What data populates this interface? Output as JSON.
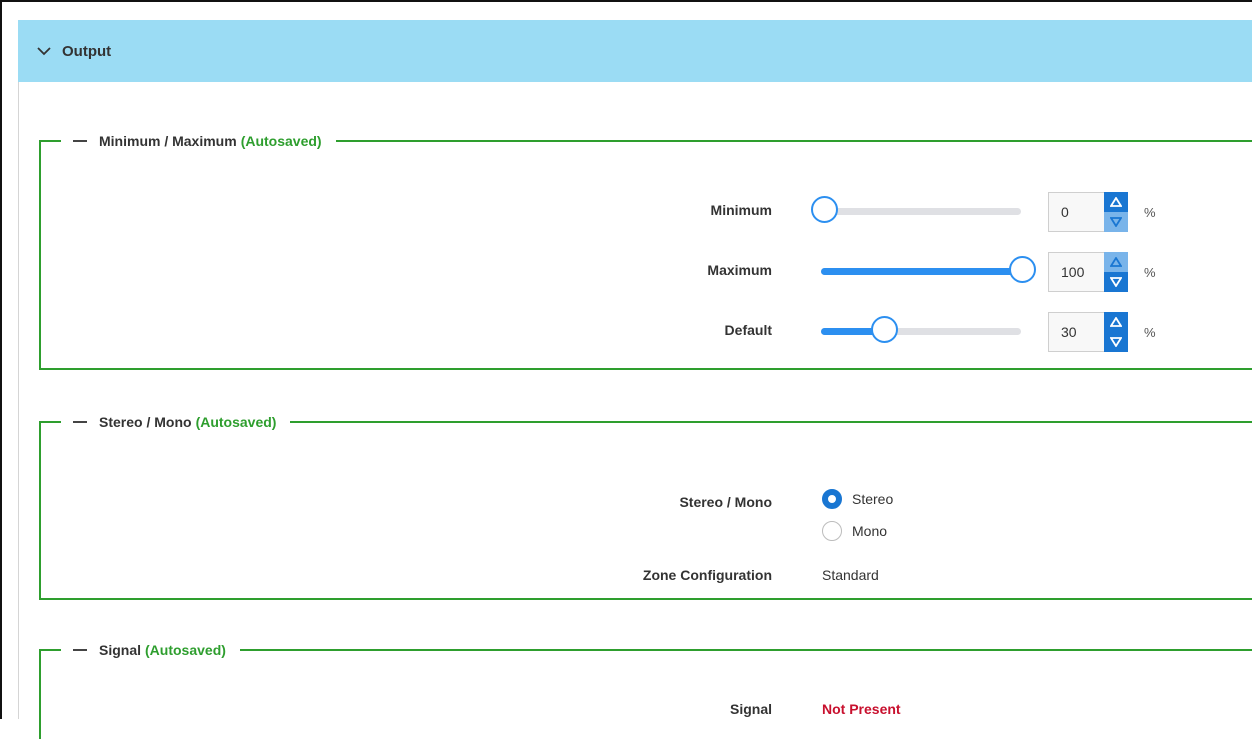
{
  "panel": {
    "title": "Output",
    "chevron_icon": "chevron-down-icon"
  },
  "minmax": {
    "legend": "Minimum / Maximum",
    "autosaved": "(Autosaved)",
    "unit": "%",
    "rows": [
      {
        "label": "Minimum",
        "value": "0",
        "percent": 0
      },
      {
        "label": "Maximum",
        "value": "100",
        "percent": 100
      },
      {
        "label": "Default",
        "value": "30",
        "percent": 30
      }
    ]
  },
  "stereo": {
    "legend": "Stereo / Mono",
    "autosaved": "(Autosaved)",
    "field_label": "Stereo / Mono",
    "options": [
      {
        "label": "Stereo",
        "selected": true
      },
      {
        "label": "Mono",
        "selected": false
      }
    ],
    "zone_label": "Zone Configuration",
    "zone_value": "Standard"
  },
  "signal": {
    "legend": "Signal",
    "autosaved": "(Autosaved)",
    "field_label": "Signal",
    "status": "Not Present"
  },
  "colors": {
    "header_bg": "#9bdcf4",
    "fieldset_border": "#2e9e2e",
    "accent_blue": "#1976d2",
    "status_red": "#c8102e"
  }
}
